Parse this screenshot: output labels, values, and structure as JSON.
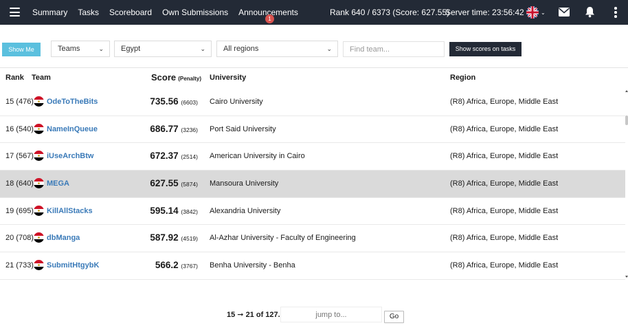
{
  "topbar": {
    "nav": [
      "Summary",
      "Tasks",
      "Scoreboard",
      "Own Submissions",
      "Announcements"
    ],
    "announcement_badge": "1",
    "rank_text": "Rank 640 / 6373 (Score: 627.55)",
    "server_time": "Server time: 23:56:42",
    "icons": [
      "menu-icon",
      "uk-flag-icon",
      "chevron-down-icon",
      "mail-icon",
      "bell-icon",
      "kebab-icon"
    ]
  },
  "filters": {
    "show_me": "Show Me",
    "type_select": "Teams",
    "country_select": "Egypt",
    "region_select": "All regions",
    "find_placeholder": "Find team...",
    "show_scores": "Show scores on tasks"
  },
  "table": {
    "headers": {
      "rank": "Rank",
      "team": "Team",
      "score": "Score",
      "penalty": "(Penalty)",
      "university": "University",
      "region": "Region"
    },
    "rows": [
      {
        "rank": "15 (476)",
        "team": "OdeToTheBits",
        "score": "735.56",
        "penalty": "(6603)",
        "university": "Cairo University",
        "region": "(R8) Africa, Europe, Middle East"
      },
      {
        "rank": "16 (540)",
        "team": "NameInQueue",
        "score": "686.77",
        "penalty": "(3236)",
        "university": "Port Said University",
        "region": "(R8) Africa, Europe, Middle East"
      },
      {
        "rank": "17 (567)",
        "team": "iUseArchBtw",
        "score": "672.37",
        "penalty": "(2514)",
        "university": "American University in Cairo",
        "region": "(R8) Africa, Europe, Middle East"
      },
      {
        "rank": "18 (640)",
        "team": "MEGA",
        "score": "627.55",
        "penalty": "(5874)",
        "university": "Mansoura University",
        "region": "(R8) Africa, Europe, Middle East"
      },
      {
        "rank": "19 (695)",
        "team": "KillAllStacks",
        "score": "595.14",
        "penalty": "(3842)",
        "university": "Alexandria University",
        "region": "(R8) Africa, Europe, Middle East"
      },
      {
        "rank": "20 (708)",
        "team": "dbManga",
        "score": "587.92",
        "penalty": "(4519)",
        "university": "Al-Azhar University - Faculty of Engineering",
        "region": "(R8) Africa, Europe, Middle East"
      },
      {
        "rank": "21 (733)",
        "team": "SubmitHtgybK",
        "score": "566.2",
        "penalty": "(3767)",
        "university": "Benha University - Benha",
        "region": "(R8) Africa, Europe, Middle East"
      }
    ],
    "highlight_color": "#dadada",
    "team_link_color": "#3a7ab8"
  },
  "pager": {
    "range_text": "15 ➞ 21 of 127.",
    "jump_placeholder": "jump to...",
    "go": "Go"
  }
}
